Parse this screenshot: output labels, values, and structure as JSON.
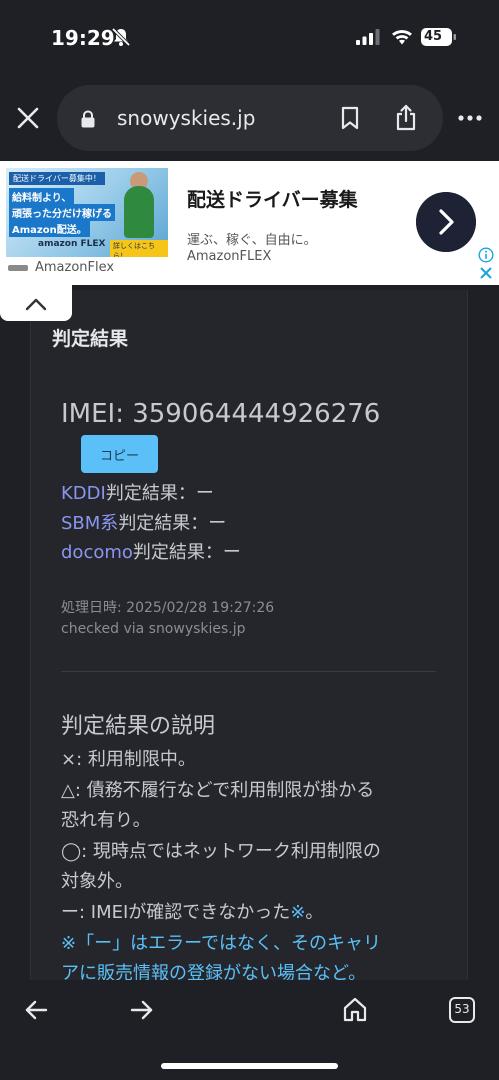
{
  "status": {
    "time": "19:29",
    "battery": "45"
  },
  "browser": {
    "url": "snowyskies.jp",
    "tab_count": "53"
  },
  "ad": {
    "image_tag": "配送ドライバー募集中！",
    "image_line1": "給料制より、",
    "image_line2": "頑張った分だけ稼げる",
    "image_line3": "Amazon配送。",
    "image_brand": "amazon FLEX",
    "image_button": "詳しくはこちら！",
    "advertiser": "AmazonFlex",
    "title": "配送ドライバー募集",
    "description": "運ぶ、稼ぐ、自由に。",
    "brand": "AmazonFLEX"
  },
  "result": {
    "section_title": "判定結果",
    "imei": "IMEI: 359064444926276",
    "copy_label": "コピー",
    "kddi_carrier": "KDDI",
    "kddi_rest": "判定結果：ー",
    "sbm_carrier": "SBM系",
    "sbm_rest": "判定結果：ー",
    "docomo_carrier": "docomo",
    "docomo_rest": "判定結果：ー",
    "processed_at": "処理日時: 2025/02/28 19:27:26",
    "checked_via": "checked via snowyskies.jp"
  },
  "explanation": {
    "title": "判定結果の説明",
    "line1": "×: 利用制限中。",
    "line2": "△: 債務不履行などで利用制限が掛かる",
    "line3": "恐れ有り。",
    "line4": "◯: 現時点ではネットワーク利用制限の",
    "line5": "対象外。",
    "line6_text": "ー: IMEIが確認できなかった",
    "line6_mark": "※",
    "line6_end": "。",
    "note1": "※「ー」はエラーではなく、そのキャリ",
    "note2": "アに販売情報の登録がない場合など。"
  }
}
